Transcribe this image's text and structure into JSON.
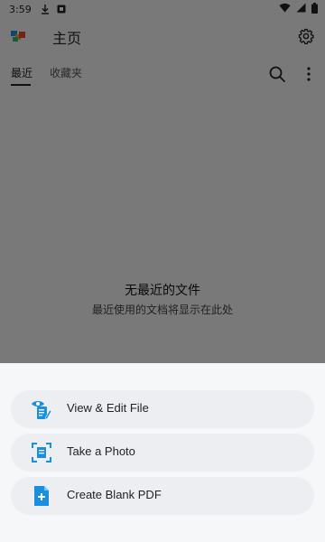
{
  "status_bar": {
    "time": "3:59"
  },
  "app_bar": {
    "title": "主页"
  },
  "tabs": [
    {
      "label": "最近",
      "selected": true
    },
    {
      "label": "收藏夹",
      "selected": false
    }
  ],
  "empty_state": {
    "title": "无最近的文件",
    "subtitle": "最近使用的文档将显示在此处"
  },
  "sheet": {
    "actions": [
      {
        "label": "View & Edit File",
        "icon": "view-edit-file-icon"
      },
      {
        "label": "Take a Photo",
        "icon": "camera-scan-icon"
      },
      {
        "label": "Create Blank PDF",
        "icon": "create-pdf-icon"
      }
    ]
  },
  "colors": {
    "accent": "#1a8fe0",
    "scrim": "rgba(0,0,0,0.5)",
    "sheet_bg": "#f6f7f9",
    "button_bg": "#eceef1"
  }
}
